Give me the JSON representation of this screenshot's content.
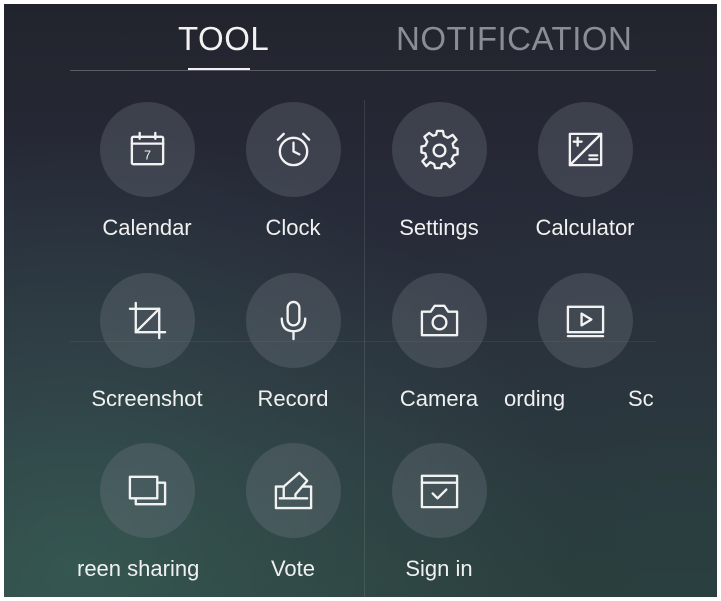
{
  "tabs": [
    {
      "label": "TOOL",
      "active": true
    },
    {
      "label": "NOTIFICATION",
      "active": false
    }
  ],
  "tools": {
    "calendar": {
      "label": "Calendar",
      "icon": "calendar-icon",
      "day": "7"
    },
    "clock": {
      "label": "Clock",
      "icon": "alarm-clock-icon"
    },
    "settings": {
      "label": "Settings",
      "icon": "gear-icon"
    },
    "calculator": {
      "label": "Calculator",
      "icon": "calculator-icon"
    },
    "screenshot": {
      "label": "Screenshot",
      "icon": "crop-icon"
    },
    "record": {
      "label": "Record",
      "icon": "microphone-icon"
    },
    "camera": {
      "label": "Camera",
      "icon": "camera-icon"
    },
    "recording": {
      "label": "ording",
      "icon": "screen-record-icon"
    },
    "partial_next": {
      "label": "Sc"
    },
    "screen_sharing": {
      "label": "reen sharing",
      "icon": "screen-share-icon"
    },
    "vote": {
      "label": "Vote",
      "icon": "vote-icon"
    },
    "sign_in": {
      "label": "Sign in",
      "icon": "sign-in-icon"
    }
  },
  "colors": {
    "active_tab": "#f2f2f2",
    "inactive_tab": "#8b8d95",
    "icon_circle": "rgba(120,125,135,0.30)",
    "background_top": "#22242d",
    "background_bottom": "#2c3b3a"
  }
}
